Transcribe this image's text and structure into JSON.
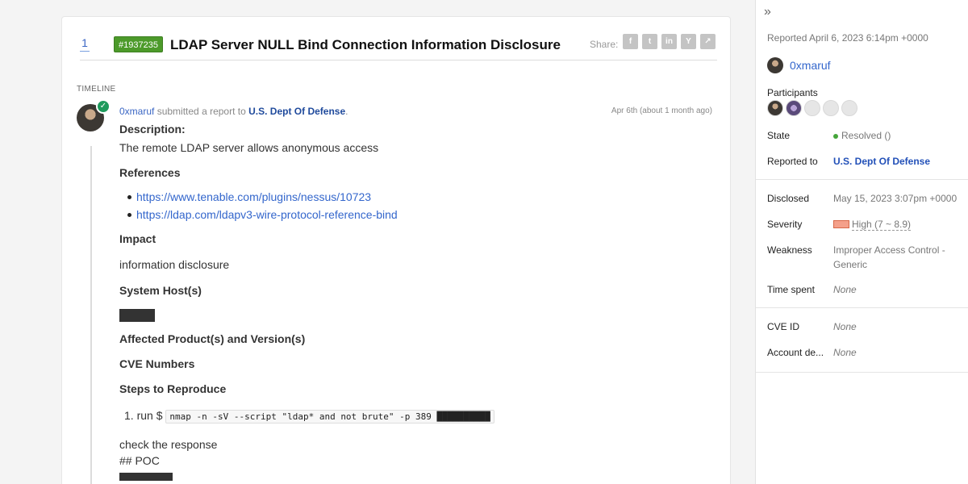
{
  "report": {
    "vote_count": "1",
    "id_badge": "#1937235",
    "title": "LDAP Server NULL Bind Connection Information Disclosure",
    "share_label": "Share:",
    "share_buttons": [
      {
        "name": "facebook-share-icon",
        "glyph": "f"
      },
      {
        "name": "twitter-share-icon",
        "glyph": "t"
      },
      {
        "name": "linkedin-share-icon",
        "glyph": "in"
      },
      {
        "name": "ycombinator-share-icon",
        "glyph": "Y"
      },
      {
        "name": "link-share-icon",
        "glyph": "↗"
      }
    ]
  },
  "timeline": {
    "label": "TIMELINE",
    "activity": {
      "user": "0xmaruf",
      "action": "submitted a report to",
      "team": "U.S. Dept Of Defense",
      "period": ".",
      "date": "Apr 6th (about 1 month ago)"
    },
    "content": {
      "description_heading": "Description:",
      "description_text": "The remote LDAP server allows anonymous access",
      "references_heading": "References",
      "references": [
        "https://www.tenable.com/plugins/nessus/10723",
        "https://ldap.com/ldapv3-wire-protocol-reference-bind"
      ],
      "impact_heading": "Impact",
      "impact_text": "information disclosure",
      "hosts_heading": "System Host(s)",
      "affected_heading": "Affected Product(s) and Version(s)",
      "cve_heading": "CVE Numbers",
      "steps_heading": "Steps to Reproduce",
      "step_number": "1.",
      "step_prefix": "run $",
      "step_command": "nmap -n -sV --script \"ldap* and not brute\" -p 389 ██████████",
      "check_text": "check the response",
      "poc_text": "## POC"
    }
  },
  "sidebar": {
    "toggle_glyph": "»",
    "reported": "Reported April 6, 2023 6:14pm +0000",
    "reporter": "0xmaruf",
    "participants_label": "Participants",
    "state_label": "State",
    "state_value": "Resolved ()",
    "reported_to_label": "Reported to",
    "reported_to_value": "U.S. Dept Of Defense",
    "disclosed_label": "Disclosed",
    "disclosed_value": "May 15, 2023 3:07pm +0000",
    "severity_label": "Severity",
    "severity_value": "High (7 ~ 8.9)",
    "weakness_label": "Weakness",
    "weakness_value_line1": "Improper Access Control -",
    "weakness_value_line2": "Generic",
    "time_spent_label": "Time spent",
    "time_spent_value": "None",
    "cve_label": "CVE ID",
    "cve_value": "None",
    "account_label": "Account de...",
    "account_value": "None"
  }
}
